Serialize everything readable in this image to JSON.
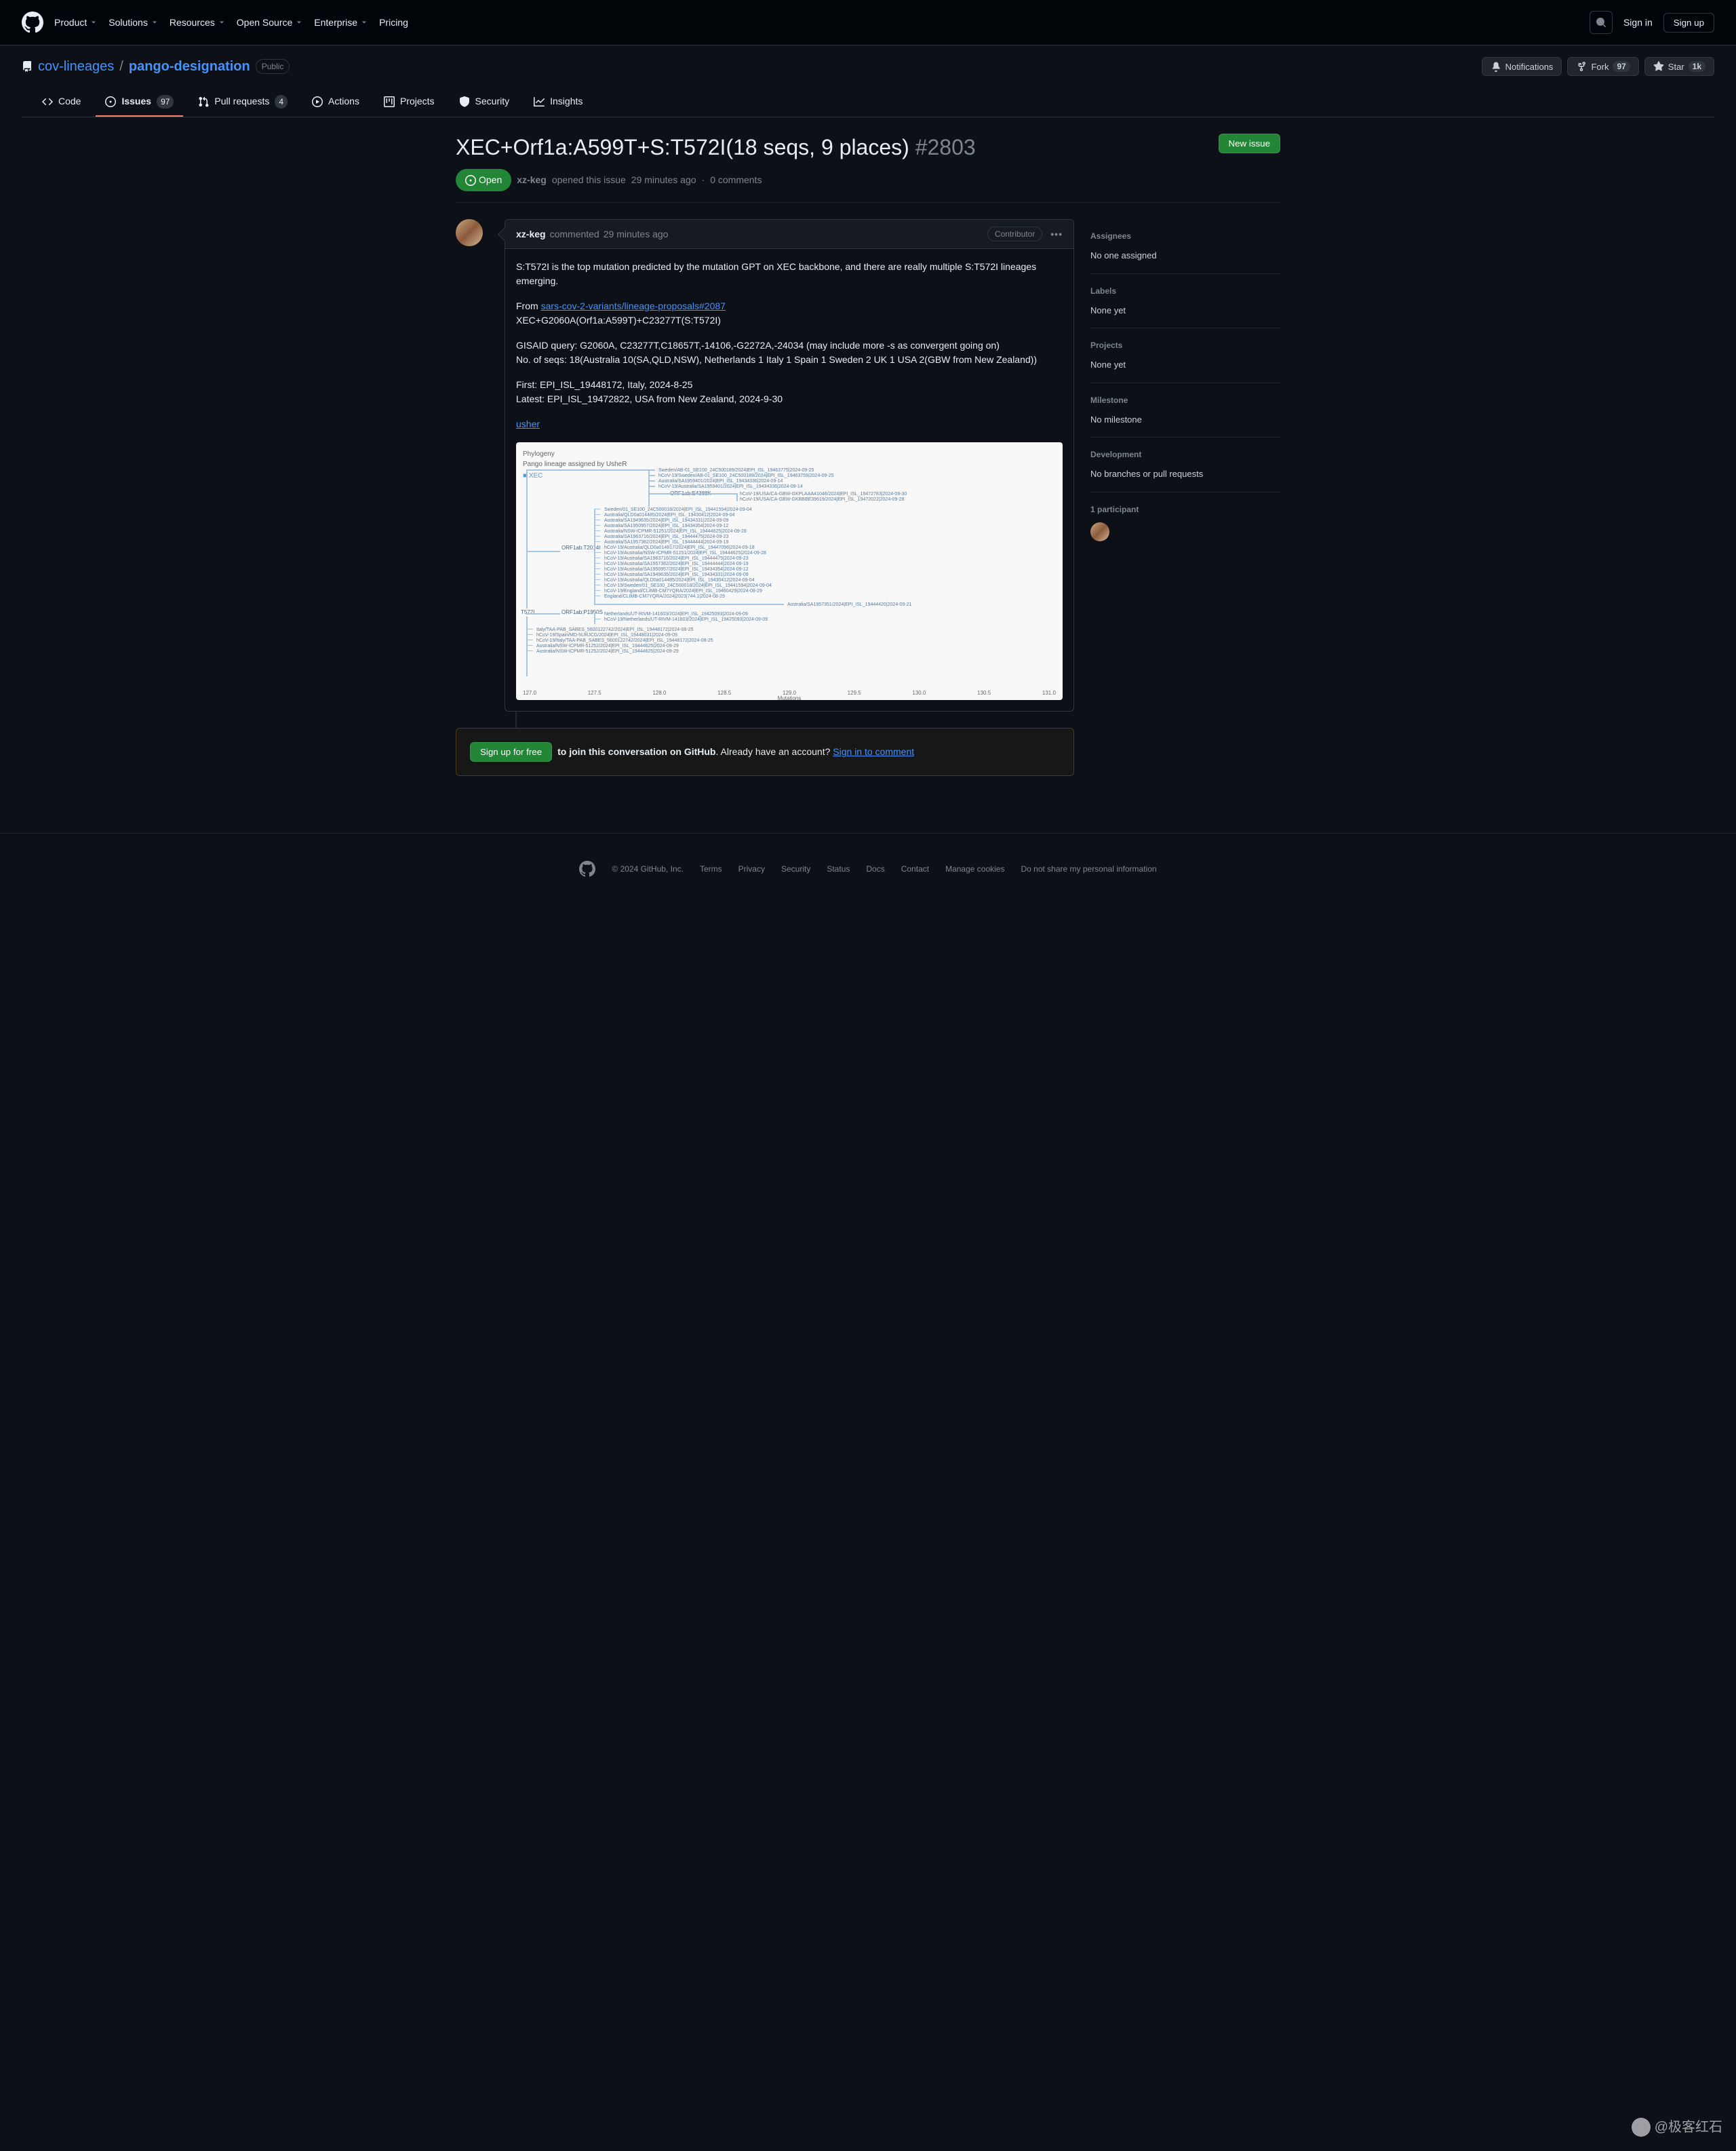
{
  "header": {
    "nav": [
      "Product",
      "Solutions",
      "Resources",
      "Open Source",
      "Enterprise",
      "Pricing"
    ],
    "sign_in": "Sign in",
    "sign_up": "Sign up"
  },
  "repo": {
    "owner": "cov-lineages",
    "name": "pango-designation",
    "visibility": "Public",
    "actions": {
      "notifications": "Notifications",
      "fork": "Fork",
      "fork_count": "97",
      "star": "Star",
      "star_count": "1k"
    }
  },
  "tabs": {
    "code": "Code",
    "issues": "Issues",
    "issues_count": "97",
    "pulls": "Pull requests",
    "pulls_count": "4",
    "actions": "Actions",
    "projects": "Projects",
    "security": "Security",
    "insights": "Insights"
  },
  "issue": {
    "title": "XEC+Orf1a:A599T+S:T572I(18 seqs, 9 places)",
    "number": "#2803",
    "new_issue": "New issue",
    "state": "Open",
    "author": "xz-keg",
    "opened_text": "opened this issue",
    "opened_time": "29 minutes ago",
    "sep": "·",
    "comments_count": "0 comments"
  },
  "comment": {
    "author": "xz-keg",
    "commented": "commented",
    "time": "29 minutes ago",
    "contributor": "Contributor",
    "body": {
      "p1": "S:T572I is the top mutation predicted by the mutation GPT on XEC backbone, and there are really multiple S:T572I lineages emerging.",
      "p2_from": "From ",
      "p2_link": "sars-cov-2-variants/lineage-proposals#2087",
      "p2_rest": "XEC+G2060A(Orf1a:A599T)+C23277T(S:T572I)",
      "p3_query": "GISAID query: G2060A, C23277T,C18657T,-14106,-G2272A,-24034 (may include more -s as convergent going on)",
      "p3_seqs": "No. of seqs: 18(Australia 10(SA,QLD,NSW), Netherlands 1 Italy 1 Spain 1 Sweden 2 UK 1 USA 2(GBW from New Zealand))",
      "p4_first": "First: EPI_ISL_19448172, Italy, 2024-8-25",
      "p4_latest": "Latest: EPI_ISL_19472822, USA from New Zealand, 2024-9-30",
      "p5_link": "usher"
    }
  },
  "phylogeny": {
    "title": "Phylogeny",
    "subtitle": "Pango lineage assigned by UsheR",
    "root": "XEC",
    "mutations": [
      "ORF1ab:E4388K",
      "ORF1ab:T2014I",
      "T572I",
      "ORF1ab:P1950S"
    ],
    "samples": [
      "Sweden/AB-01_SE100_24C500189/2024|EPI_ISL_19463775|2024-09-25",
      "hCoV-19/Sweden/AB-01_SE100_24C500189/2024|EPI_ISL_19463759|2024-09-25",
      "Australia/SA1959401/2024|EPI_ISL_19434336|2024-09-14",
      "hCoV-19/Australia/SA1959401/2024|EPI_ISL_19434336|2024-09-14",
      "hCoV-19/USA/CA-GBW-GKPLAAA41046/2024|EPI_ISL_19472783|2024-09-30",
      "hCoV-19/USA/CA-GBW-GKBBBE39619/2024|EPI_ISL_19472022|2024-09-28",
      "Sweden/01_SE100_24C500018/2024|EPI_ISL_19441594|2024-09-04",
      "Australia/QLD0a014485/2024|EPI_ISL_19430412|2024-09-04",
      "Australia/SA1949635/2024|EPI_ISL_19434331|2024-09-09",
      "Australia/SA1950957/2024|EPI_ISL_19434354|2024-09-12",
      "Australia/NSW-ICPMR-51251/2024|EPI_ISL_19444625|2024-09-28",
      "Australia/SA1963716/2024|EPI_ISL_19444475|2024-09-23",
      "Australia/SA1957382/2024|EPI_ISL_19444444|2024-09-19",
      "hCoV-19/Australia/QLD0a014817/2024|EPI_ISL_19447096|2024-09-18",
      "hCoV-19/Australia/NSW-ICPMR-51251/2024|EPI_ISL_19444625|2024-09-28",
      "hCoV-19/Australia/SA1963716/2024|EPI_ISL_19444475|2024-09-23",
      "hCoV-19/Australia/SA1957382/2024|EPI_ISL_19444444|2024-09-19",
      "hCoV-19/Australia/SA1950957/2024|EPI_ISL_19434354|2024-09-12",
      "hCoV-19/Australia/SA1949635/2024|EPI_ISL_19434331|2024-09-09",
      "hCoV-19/Australia/QLD0a014485/2024|EPI_ISL_19430412|2024-09-04",
      "hCoV-19/Sweden/01_SE100_24C500018/2024|EPI_ISL_19441594|2024-09-04",
      "hCoV-19/England/CLIMB-CM7YQRA/2024|EPI_ISL_19460429|2024-08-29",
      "England/CLIMB-CM7YQRA/2024|2023|744.1|2024-08-29",
      "Australia/SA1957351/2024|EPI_ISL_19444420|2024-09-21",
      "Netherlands/UT-RIVM-141603/2024|EPI_ISL_19425093|2024-09-09",
      "hCoV-19/Netherlands/UT-RIVM-141603/2024|EPI_ISL_19425093|2024-09-09",
      "Italy/TAA-PAB_SABES_5600122742/2024|EPI_ISL_19448172|2024-08-25",
      "hCoV-19/Spain/MD-hURJCG/2024|EPI_ISL_19448031|2024-09-09",
      "hCoV-19/Italy/TAA-PAB_SABES_5600122742/2024|EPI_ISL_19448172|2024-08-25",
      "Australia/NSW-ICPMR-51252/2024|EPI_ISL_19444625|2024-09-29",
      "Australia/NSW-ICPMR-51252/2024|EPI_ISL_19444625|2024-09-29"
    ],
    "axis_ticks": [
      "127.0",
      "127.5",
      "128.0",
      "128.5",
      "129.0",
      "129.5",
      "130.0",
      "130.5",
      "131.0"
    ],
    "axis_label": "Mutations"
  },
  "sidebar": {
    "assignees": {
      "label": "Assignees",
      "value": "No one assigned"
    },
    "labels": {
      "label": "Labels",
      "value": "None yet"
    },
    "projects": {
      "label": "Projects",
      "value": "None yet"
    },
    "milestone": {
      "label": "Milestone",
      "value": "No milestone"
    },
    "development": {
      "label": "Development",
      "value": "No branches or pull requests"
    },
    "participants": {
      "label": "1 participant"
    }
  },
  "signup": {
    "button": "Sign up for free",
    "text1": "to join this conversation on GitHub",
    "text2": ". Already have an account? ",
    "link": "Sign in to comment"
  },
  "footer": {
    "copyright": "© 2024 GitHub, Inc.",
    "links": [
      "Terms",
      "Privacy",
      "Security",
      "Status",
      "Docs",
      "Contact",
      "Manage cookies",
      "Do not share my personal information"
    ]
  },
  "watermark": "@极客红石"
}
